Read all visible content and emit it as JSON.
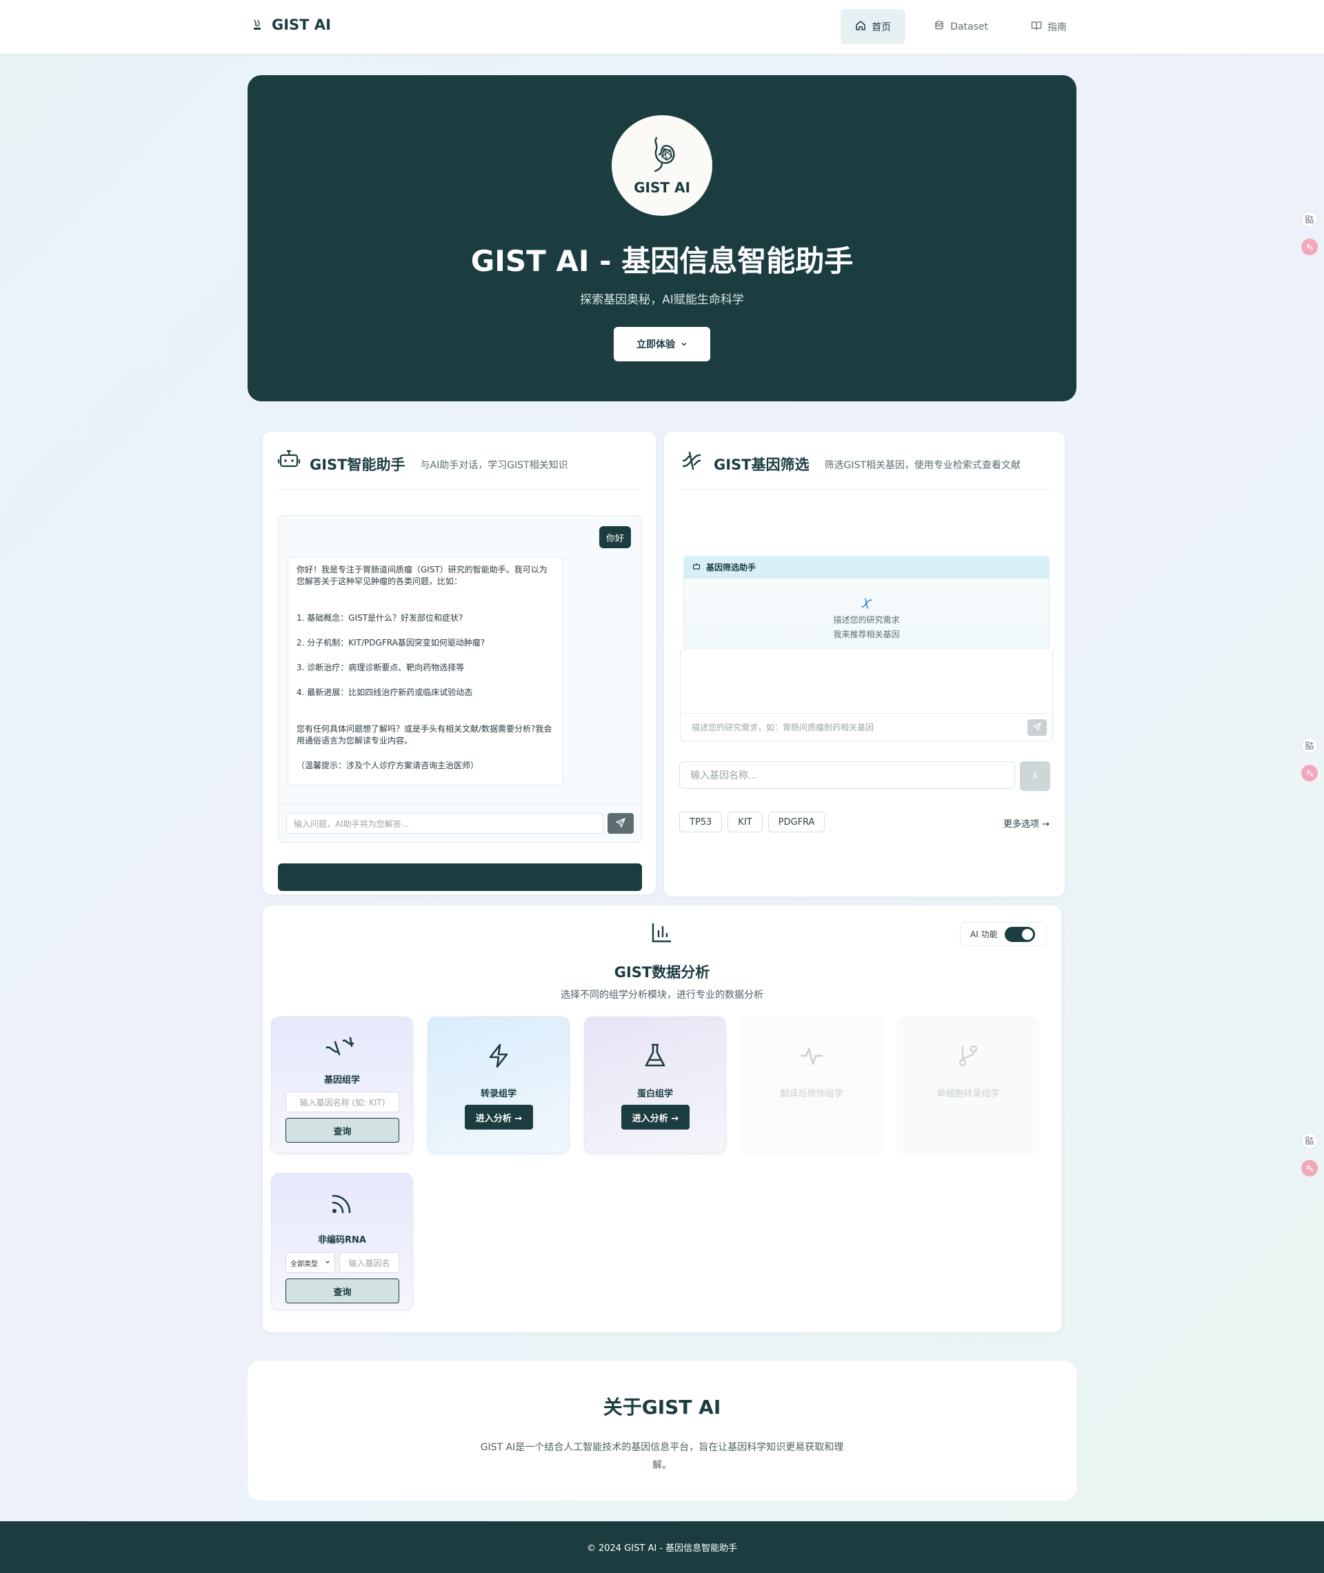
{
  "nav": {
    "brand": "GIST AI",
    "items": [
      {
        "label": "首页",
        "icon": "home-icon",
        "active": true
      },
      {
        "label": "Dataset",
        "icon": "database-icon",
        "active": false
      },
      {
        "label": "指南",
        "icon": "book-icon",
        "active": false
      }
    ]
  },
  "hero": {
    "logo_text": "GIST AI",
    "title": "GIST AI - 基因信息智能助手",
    "subtitle": "探索基因奥秘，AI赋能生命科学",
    "cta": "立即体验"
  },
  "assistant": {
    "title": "GIST智能助手",
    "desc": "与AI助手对话，学习GIST相关知识",
    "user_msg": "你好",
    "ai_lines": {
      "l1": "你好！我是专注于胃肠道间质瘤（GIST）研究的智能助手。我可以为您解答关于这种罕见肿瘤的各类问题，比如：",
      "l2": "1. 基础概念：GIST是什么？好发部位和症状?",
      "l3": "2. 分子机制：KIT/PDGFRA基因突变如何驱动肿瘤?",
      "l4": "3. 诊断治疗：病理诊断要点、靶向药物选择等",
      "l5": "4. 最新进展：比如四线治疗新药或临床试验动态",
      "l6": "您有任何具体问题想了解吗？或是手头有相关文献/数据需要分析?我会用通俗语言为您解读专业内容。",
      "l7": "（温馨提示：涉及个人诊疗方案请咨询主治医师）"
    },
    "input_placeholder": "输入问题，AI助手将为您解答..."
  },
  "gene": {
    "title": "GIST基因筛选",
    "desc": "筛选GIST相关基因，使用专业检索式查看文献",
    "box_title": "基因筛选助手",
    "hint1": "描述您的研究需求",
    "hint2": "我来推荐相关基因",
    "box_placeholder": "描述您的研究需求，如：胃肠间质瘤耐药相关基因",
    "search_placeholder": "输入基因名称...",
    "tags": [
      "TP53",
      "KIT",
      "PDGFRA"
    ],
    "more": "更多选项 →"
  },
  "analysis": {
    "title": "GIST数据分析",
    "subtitle": "选择不同的组学分析模块，进行专业的数据分析",
    "toggle_label": "AI 功能",
    "toggle_on": true,
    "cards": {
      "genomics": {
        "label": "基因组学",
        "input": "输入基因名称 (如: KIT)",
        "button": "查询"
      },
      "transcriptomics": {
        "label": "转录组学",
        "button": "进入分析 →"
      },
      "proteomics": {
        "label": "蛋白组学",
        "button": "进入分析 →"
      },
      "ptm": {
        "label": "翻译后修饰组学"
      },
      "singlecell": {
        "label": "单细胞转录组学"
      },
      "ncrna": {
        "label": "非编码RNA",
        "select": "全部类型",
        "input": "输入基因名",
        "button": "查询"
      }
    }
  },
  "about": {
    "title": "关于GIST AI",
    "text": "GIST AI是一个结合人工智能技术的基因信息平台，旨在让基因科学知识更易获取和理解。"
  },
  "footer": {
    "text": "© 2024 GIST AI - 基因信息智能助手"
  },
  "colors": {
    "primary": "#1b3d40",
    "accent_light": "#e7f1f4"
  }
}
